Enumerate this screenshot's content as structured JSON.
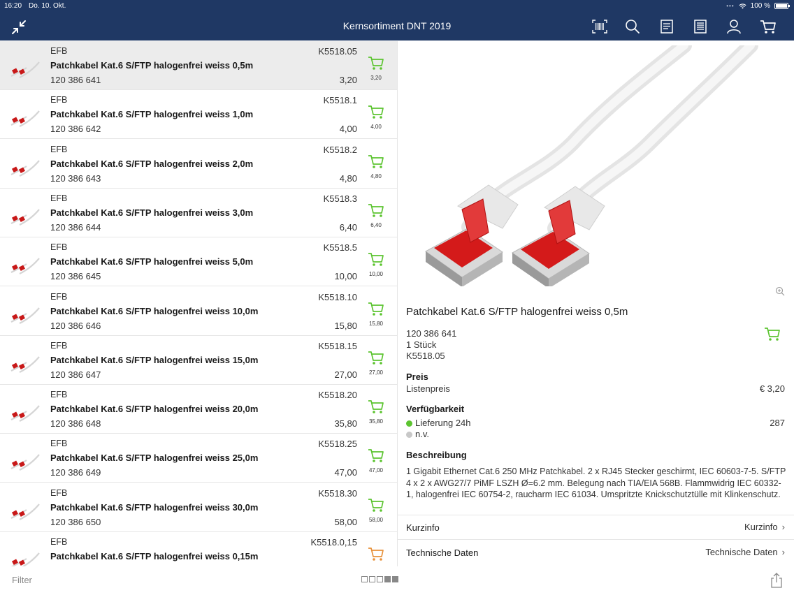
{
  "status_bar": {
    "time": "16:20",
    "date": "Do. 10. Okt.",
    "dots": "•••",
    "battery": "100 %"
  },
  "header": {
    "title": "Kernsortiment DNT 2019"
  },
  "products": [
    {
      "brand": "EFB",
      "name": "Patchkabel Kat.6 S/FTP halogenfrei weiss 0,5m",
      "number": "120 386 641",
      "code": "K5518.05",
      "price": "3,20",
      "cart_price": "3,20",
      "selected": true
    },
    {
      "brand": "EFB",
      "name": "Patchkabel Kat.6 S/FTP halogenfrei weiss 1,0m",
      "number": "120 386 642",
      "code": "K5518.1",
      "price": "4,00",
      "cart_price": "4,00"
    },
    {
      "brand": "EFB",
      "name": "Patchkabel Kat.6 S/FTP halogenfrei weiss 2,0m",
      "number": "120 386 643",
      "code": "K5518.2",
      "price": "4,80",
      "cart_price": "4,80"
    },
    {
      "brand": "EFB",
      "name": "Patchkabel Kat.6 S/FTP halogenfrei weiss 3,0m",
      "number": "120 386 644",
      "code": "K5518.3",
      "price": "6,40",
      "cart_price": "6,40"
    },
    {
      "brand": "EFB",
      "name": "Patchkabel Kat.6 S/FTP halogenfrei weiss 5,0m",
      "number": "120 386 645",
      "code": "K5518.5",
      "price": "10,00",
      "cart_price": "10,00"
    },
    {
      "brand": "EFB",
      "name": "Patchkabel Kat.6 S/FTP halogenfrei weiss 10,0m",
      "number": "120 386 646",
      "code": "K5518.10",
      "price": "15,80",
      "cart_price": "15,80"
    },
    {
      "brand": "EFB",
      "name": "Patchkabel Kat.6 S/FTP halogenfrei weiss 15,0m",
      "number": "120 386 647",
      "code": "K5518.15",
      "price": "27,00",
      "cart_price": "27,00"
    },
    {
      "brand": "EFB",
      "name": "Patchkabel Kat.6 S/FTP halogenfrei weiss 20,0m",
      "number": "120 386 648",
      "code": "K5518.20",
      "price": "35,80",
      "cart_price": "35,80"
    },
    {
      "brand": "EFB",
      "name": "Patchkabel Kat.6 S/FTP halogenfrei weiss 25,0m",
      "number": "120 386 649",
      "code": "K5518.25",
      "price": "47,00",
      "cart_price": "47,00"
    },
    {
      "brand": "EFB",
      "name": "Patchkabel Kat.6 S/FTP halogenfrei weiss 30,0m",
      "number": "120 386 650",
      "code": "K5518.30",
      "price": "58,00",
      "cart_price": "58,00"
    },
    {
      "brand": "EFB",
      "name": "Patchkabel Kat.6 S/FTP halogenfrei weiss 0,15m",
      "number": "",
      "code": "K5518.0,15",
      "price": "",
      "cart_price": "",
      "cart_color": "#e8913a"
    }
  ],
  "detail": {
    "title": "Patchkabel Kat.6 S/FTP halogenfrei weiss 0,5m",
    "number": "120 386 641",
    "unit": "1 Stück",
    "code": "K5518.05",
    "price_heading": "Preis",
    "price_label": "Listenpreis",
    "price_value": "€ 3,20",
    "availability_heading": "Verfügbarkeit",
    "availability": [
      {
        "label": "Lieferung 24h",
        "value": "287",
        "color": "#5cc430"
      },
      {
        "label": "n.v.",
        "value": "",
        "color": "#c8c8c8"
      }
    ],
    "description_heading": "Beschreibung",
    "description": "1 Gigabit Ethernet Cat.6 250 MHz Patchkabel. 2 x RJ45 Stecker geschirmt, IEC 60603-7-5. S/FTP 4 x 2 x AWG27/7 PiMF LSZH Ø=6.2 mm. Belegung nach TIA/EIA 568B. Flammwidrig IEC 60332-1, halogenfrei IEC 60754-2, raucharm IEC 61034. Umspritzte Knickschutztülle mit Klinkenschutz.",
    "links": [
      {
        "label": "Kurzinfo",
        "value": "Kurzinfo"
      },
      {
        "label": "Technische Daten",
        "value": "Technische Daten"
      }
    ]
  },
  "bottom": {
    "filter_label": "Filter",
    "pages": [
      false,
      false,
      false,
      true,
      true
    ]
  },
  "colors": {
    "header_bg": "#1f3864",
    "cart_green": "#5cc430",
    "cart_orange": "#e8913a"
  },
  "icons": [
    "collapse-icon",
    "barcode-icon",
    "search-icon",
    "notepad-icon",
    "list-icon",
    "user-icon",
    "cart-icon",
    "zoom-icon",
    "share-icon"
  ]
}
